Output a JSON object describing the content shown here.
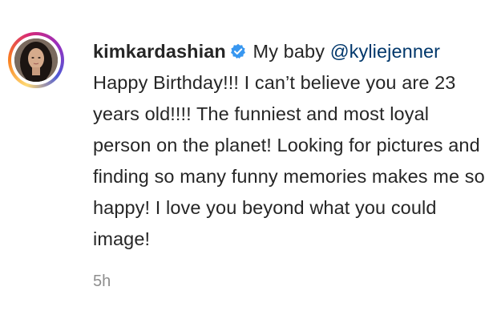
{
  "comment": {
    "username": "kimkardashian",
    "verified_icon": "verified-badge-icon",
    "badge_color": "#3897f0",
    "text_before_mention": "My baby",
    "mention": "@kyliejenner",
    "text_after_mention": "Happy Birthday!!! I can’t believe you are 23 years old!!!! The funniest and most loyal person on the planet! Looking for pictures and finding so many funny memories makes me so happy! I love you beyond what you could image!",
    "timestamp": "5h"
  }
}
